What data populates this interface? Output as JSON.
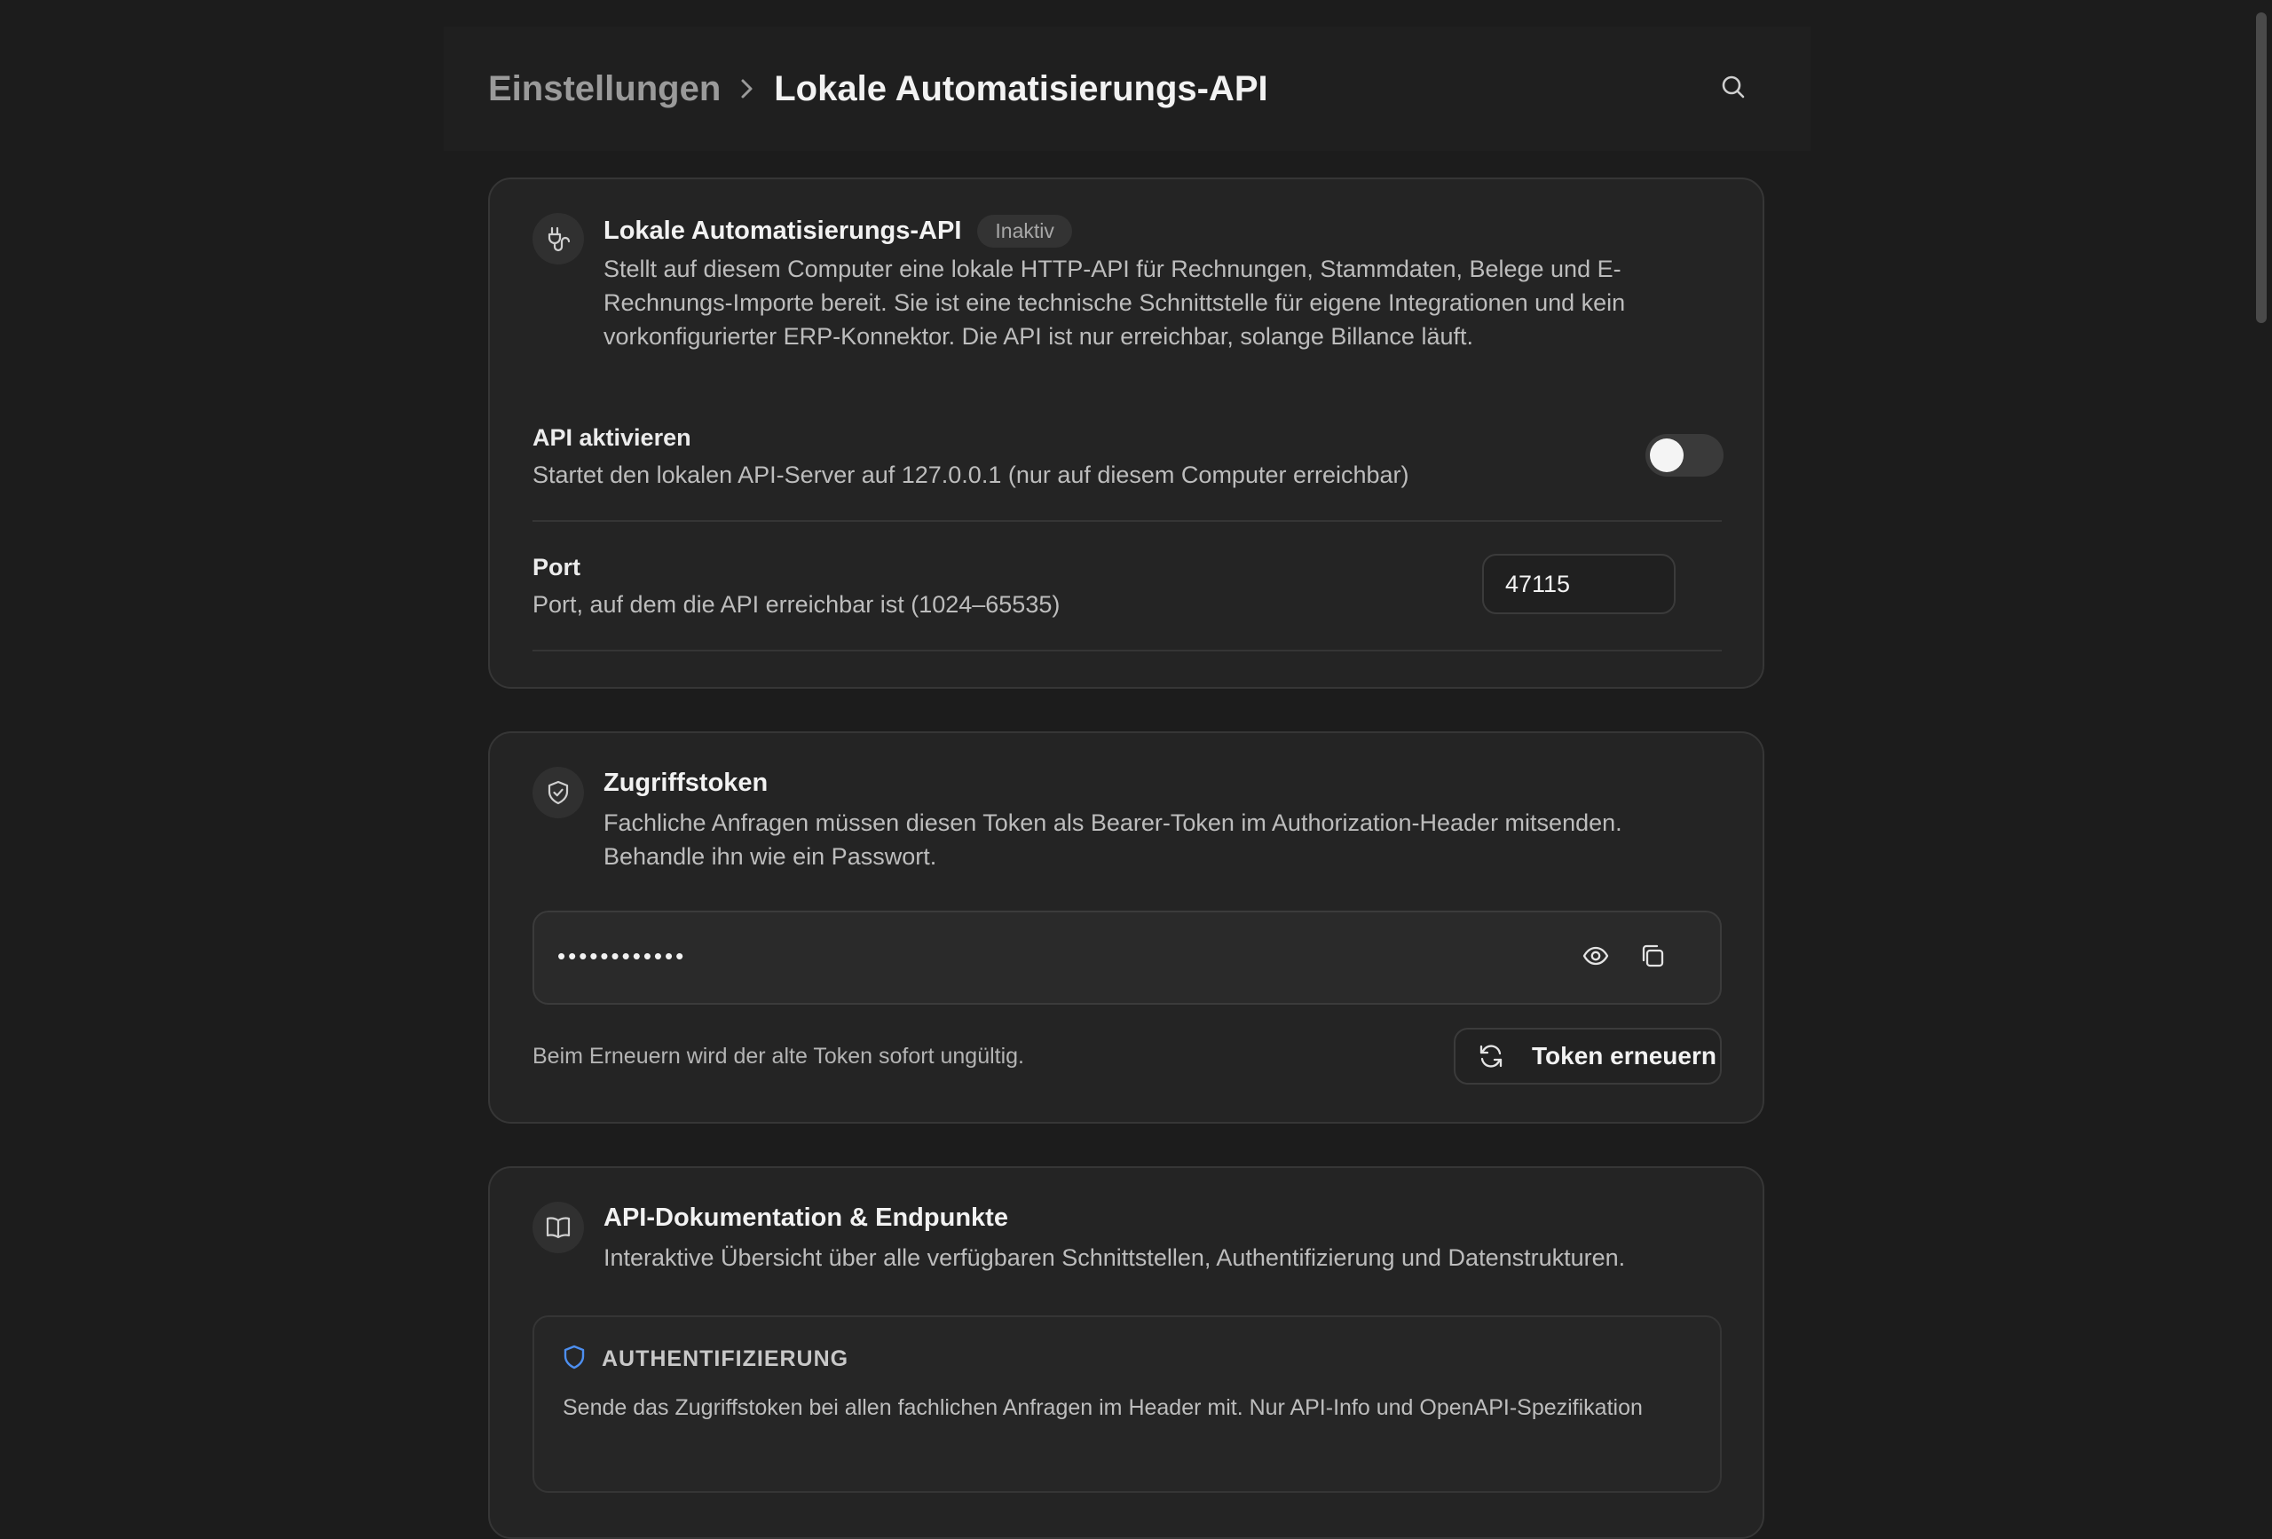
{
  "header": {
    "breadcrumb_parent": "Einstellungen",
    "breadcrumb_current": "Lokale Automatisierungs-API",
    "search_icon": "search-icon"
  },
  "api_card": {
    "icon": "plug-icon",
    "title": "Lokale Automatisierungs-API",
    "status_badge": "Inaktiv",
    "description": "Stellt auf diesem Computer eine lokale HTTP-API für Rechnungen, Stammdaten, Belege und E-Rechnungs-Importe bereit. Sie ist eine technische Schnittstelle für eigene Integrationen und kein vorkonfigurierter ERP-Konnektor. Die API ist nur erreichbar, solange Billance läuft.",
    "enable": {
      "label": "API aktivieren",
      "description": "Startet den lokalen API-Server auf 127.0.0.1 (nur auf diesem Computer erreichbar)",
      "enabled": false
    },
    "port": {
      "label": "Port",
      "description": "Port, auf dem die API erreichbar ist (1024–65535)",
      "value": "47115"
    }
  },
  "token_card": {
    "icon": "shield-check-icon",
    "title": "Zugriffstoken",
    "description": "Fachliche Anfragen müssen diesen Token als Bearer-Token im Authorization-Header mitsenden. Behandle ihn wie ein Passwort.",
    "masked_token": "••••••••••••",
    "show_icon": "eye-icon",
    "copy_icon": "copy-icon",
    "renew_note": "Beim Erneuern wird der alte Token sofort ungültig.",
    "renew_button": "Token erneuern",
    "renew_icon": "refresh-icon"
  },
  "docs_card": {
    "icon": "book-icon",
    "title": "API-Dokumentation & Endpunkte",
    "description": "Interaktive Übersicht über alle verfügbaren Schnittstellen, Authentifizierung und Datenstrukturen.",
    "auth": {
      "icon": "shield-icon",
      "title": "AUTHENTIFIZIERUNG",
      "text": "Sende das Zugriffstoken bei allen fachlichen Anfragen im Header mit. Nur API-Info und OpenAPI-Spezifikation"
    }
  },
  "colors": {
    "background": "#1c1c1c",
    "card": "#242424",
    "accent_blue": "#4d8ff0"
  }
}
